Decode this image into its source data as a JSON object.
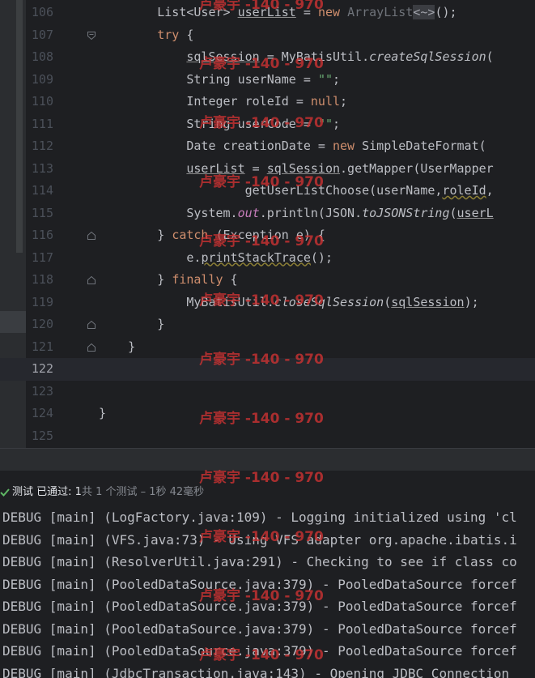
{
  "editor": {
    "lines": [
      {
        "num": "106",
        "fold": "none",
        "cur": false,
        "segs": [
          {
            "t": "        List<User> "
          },
          {
            "t": "userList",
            "c": "u"
          },
          {
            "t": " = "
          },
          {
            "t": "new ",
            "c": "kw"
          },
          {
            "t": "ArrayList",
            "c": "gr"
          },
          {
            "t": "<~>",
            "c": "diamond"
          },
          {
            "t": "();"
          }
        ]
      },
      {
        "num": "107",
        "fold": "open",
        "cur": false,
        "segs": [
          {
            "t": "        "
          },
          {
            "t": "try",
            "c": "kw"
          },
          {
            "t": " {"
          }
        ]
      },
      {
        "num": "108",
        "fold": "none",
        "cur": false,
        "segs": [
          {
            "t": "            "
          },
          {
            "t": "sqlSession",
            "c": "u"
          },
          {
            "t": " = MyBatisUtil."
          },
          {
            "t": "createSqlSession",
            "c": "ital"
          },
          {
            "t": "("
          }
        ]
      },
      {
        "num": "109",
        "fold": "none",
        "cur": false,
        "segs": [
          {
            "t": "            String userName = "
          },
          {
            "t": "\"\"",
            "c": "str"
          },
          {
            "t": ";"
          }
        ]
      },
      {
        "num": "110",
        "fold": "none",
        "cur": false,
        "segs": [
          {
            "t": "            Integer roleId = "
          },
          {
            "t": "null",
            "c": "kw"
          },
          {
            "t": ";"
          }
        ]
      },
      {
        "num": "111",
        "fold": "none",
        "cur": false,
        "segs": [
          {
            "t": "            String userCode = "
          },
          {
            "t": "\"\"",
            "c": "str"
          },
          {
            "t": ";"
          }
        ]
      },
      {
        "num": "112",
        "fold": "none",
        "cur": false,
        "segs": [
          {
            "t": "            Date creationDate = "
          },
          {
            "t": "new ",
            "c": "kw"
          },
          {
            "t": "SimpleDateFormat("
          }
        ]
      },
      {
        "num": "113",
        "fold": "none",
        "cur": false,
        "segs": [
          {
            "t": "            "
          },
          {
            "t": "userList",
            "c": "u"
          },
          {
            "t": " = "
          },
          {
            "t": "sqlSession",
            "c": "u"
          },
          {
            "t": ".getMapper(UserMapper"
          }
        ]
      },
      {
        "num": "114",
        "fold": "none",
        "cur": false,
        "segs": [
          {
            "t": "                    getUserListChoose(userName,"
          },
          {
            "t": "roleId",
            "c": "wavy"
          },
          {
            "t": ","
          }
        ]
      },
      {
        "num": "115",
        "fold": "none",
        "cur": false,
        "segs": [
          {
            "t": "            System."
          },
          {
            "t": "out",
            "c": "fld ital"
          },
          {
            "t": ".println(JSON."
          },
          {
            "t": "toJSONString",
            "c": "ital"
          },
          {
            "t": "("
          },
          {
            "t": "userL",
            "c": "u"
          }
        ]
      },
      {
        "num": "116",
        "fold": "close",
        "cur": false,
        "segs": [
          {
            "t": "        } "
          },
          {
            "t": "catch",
            "c": "kw"
          },
          {
            "t": " (Exception e) {"
          }
        ]
      },
      {
        "num": "117",
        "fold": "none",
        "cur": false,
        "segs": [
          {
            "t": "            e."
          },
          {
            "t": "printStackTrace",
            "c": "wavy"
          },
          {
            "t": "();"
          }
        ]
      },
      {
        "num": "118",
        "fold": "close",
        "cur": false,
        "segs": [
          {
            "t": "        } "
          },
          {
            "t": "finally",
            "c": "kw"
          },
          {
            "t": " {"
          }
        ]
      },
      {
        "num": "119",
        "fold": "none",
        "cur": false,
        "segs": [
          {
            "t": "            MyBatisUtil."
          },
          {
            "t": "closeSqlSession",
            "c": "ital"
          },
          {
            "t": "("
          },
          {
            "t": "sqlSession",
            "c": "u"
          },
          {
            "t": ");"
          }
        ]
      },
      {
        "num": "120",
        "fold": "close",
        "cur": false,
        "segs": [
          {
            "t": "        }"
          }
        ]
      },
      {
        "num": "121",
        "fold": "close",
        "cur": false,
        "segs": [
          {
            "t": "    }"
          }
        ]
      },
      {
        "num": "122",
        "fold": "none",
        "cur": true,
        "segs": [
          {
            "t": ""
          }
        ]
      },
      {
        "num": "123",
        "fold": "none",
        "cur": false,
        "segs": [
          {
            "t": ""
          }
        ]
      },
      {
        "num": "124",
        "fold": "none",
        "cur": false,
        "segs": [
          {
            "t": "}"
          }
        ]
      },
      {
        "num": "125",
        "fold": "none",
        "cur": false,
        "segs": [
          {
            "t": ""
          }
        ]
      }
    ]
  },
  "run": {
    "status_label": "测试 已通过: ",
    "passed": "1",
    "summary": "共 1 个测试 – 1秒 42毫秒"
  },
  "console": {
    "lines": [
      "DEBUG [main] (LogFactory.java:109) - Logging initialized using 'cl",
      "DEBUG [main] (VFS.java:73) - Using VFS adapter org.apache.ibatis.i",
      "DEBUG [main] (ResolverUtil.java:291) - Checking to see if class co",
      "DEBUG [main] (PooledDataSource.java:379) - PooledDataSource forcef",
      "DEBUG [main] (PooledDataSource.java:379) - PooledDataSource forcef",
      "DEBUG [main] (PooledDataSource.java:379) - PooledDataSource forcef",
      "DEBUG [main] (PooledDataSource.java:379) - PooledDataSource forcef",
      "DEBUG [main] (JdbcTransaction.java:143) - Opening JDBC Connection"
    ]
  },
  "watermark": {
    "text": "卢豪宇 -140 - 970",
    "color": "#c83232"
  }
}
